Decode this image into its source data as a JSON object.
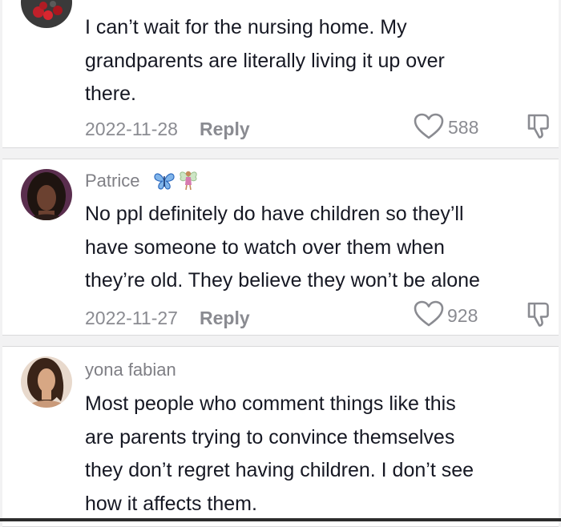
{
  "comments": [
    {
      "username": "",
      "text": "I can’t wait for the nursing home. My\ngrandparents are literally living it up over\nthere.",
      "date": "2022-11-28",
      "reply_label": "Reply",
      "likes": "588",
      "icons": {
        "like": "heart-outline-icon",
        "dislike": "thumbs-down-icon"
      }
    },
    {
      "username": "Patrice",
      "badges": [
        "butterfly-emoji",
        "fairy-emoji"
      ],
      "text": "No ppl definitely do have children so they’ll\nhave someone to watch over them when\nthey’re old. They believe they won’t be alone",
      "date": "2022-11-27",
      "reply_label": "Reply",
      "likes": "928",
      "icons": {
        "like": "heart-outline-icon",
        "dislike": "thumbs-down-icon"
      }
    },
    {
      "username": "yona fabian",
      "text": "Most people who comment things like this\nare parents trying to convince themselves\nthey don’t regret having children. I don’t see\nhow it affects them."
    }
  ],
  "colors": {
    "text": "#161823",
    "meta": "#8a8b91",
    "username": "#7f7f85",
    "card": "#ffffff",
    "background": "#f2f2f3"
  }
}
